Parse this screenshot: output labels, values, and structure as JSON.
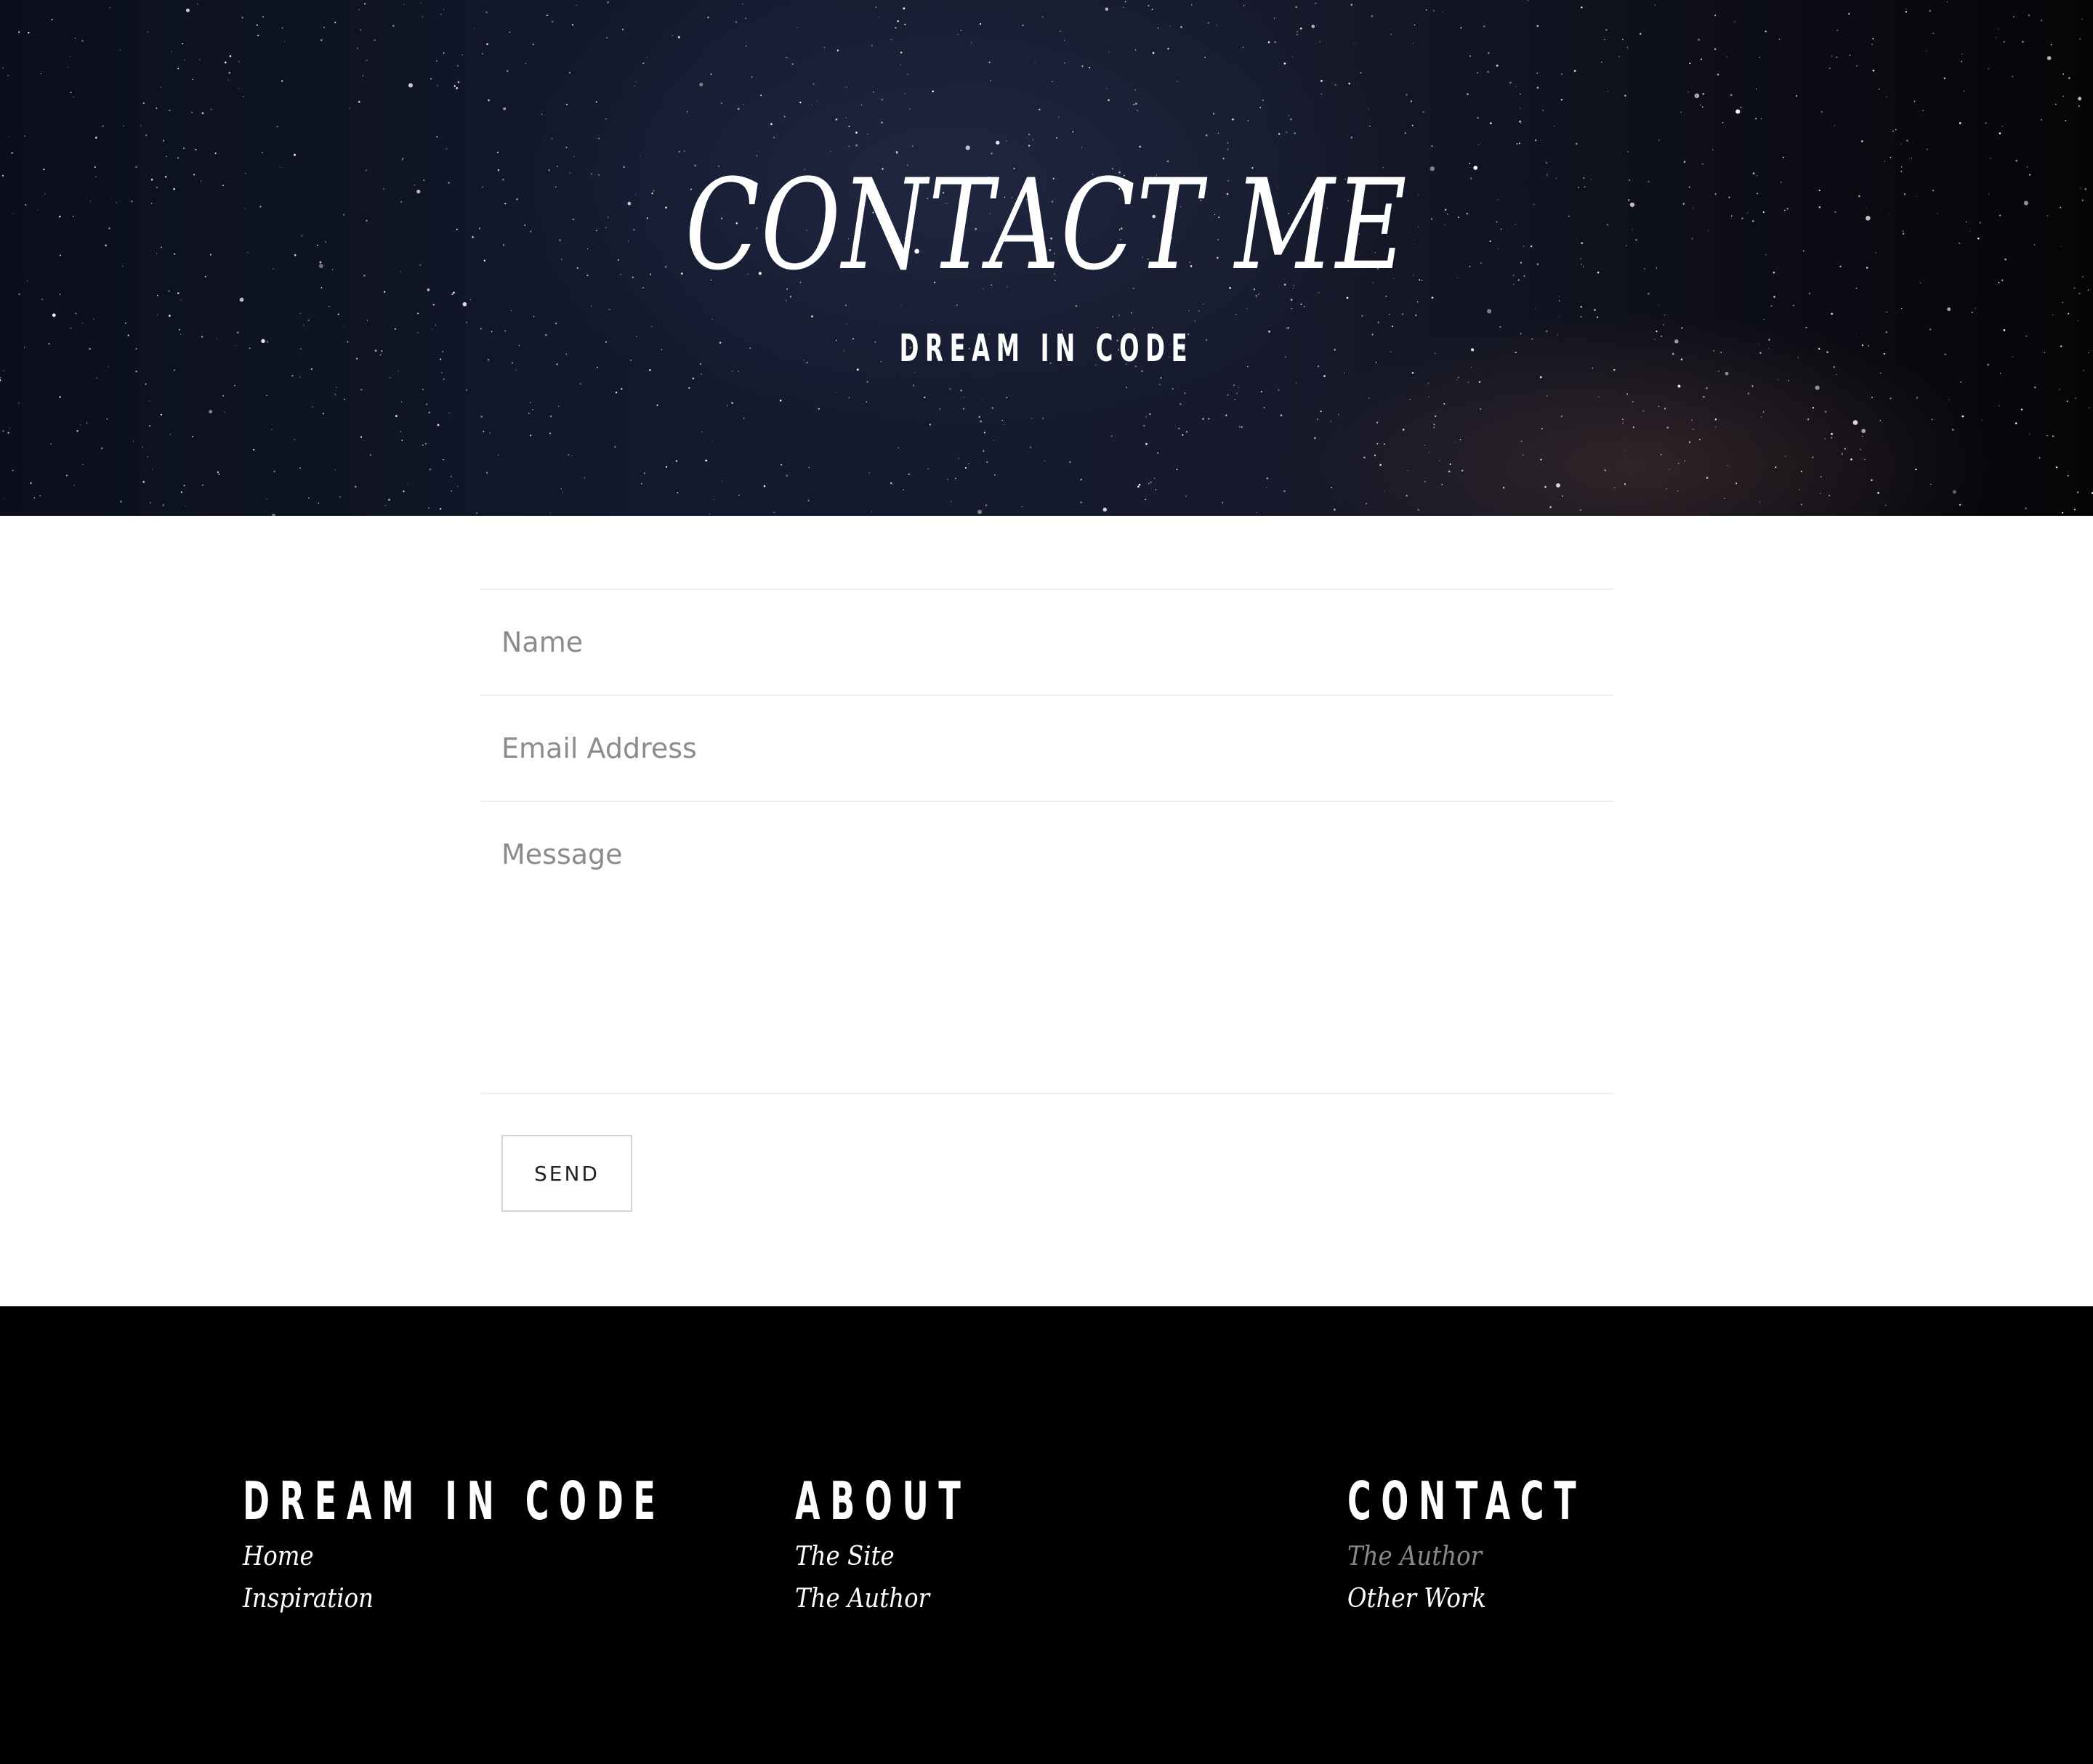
{
  "hero": {
    "title": "CONTACT ME",
    "subtitle": "DREAM IN CODE"
  },
  "form": {
    "name_placeholder": "Name",
    "email_placeholder": "Email Address",
    "message_placeholder": "Message",
    "send_label": "SEND"
  },
  "footer": {
    "columns": [
      {
        "heading": "DREAM IN CODE",
        "links": [
          "Home",
          "Inspiration"
        ]
      },
      {
        "heading": "ABOUT",
        "links": [
          "The Site",
          "The Author"
        ]
      },
      {
        "heading": "CONTACT",
        "links": [
          "The Author",
          "Other Work"
        ]
      }
    ]
  },
  "colors": {
    "footer_bg": "#000000",
    "muted_link": "#8a8a8a",
    "divider": "#ececec"
  }
}
